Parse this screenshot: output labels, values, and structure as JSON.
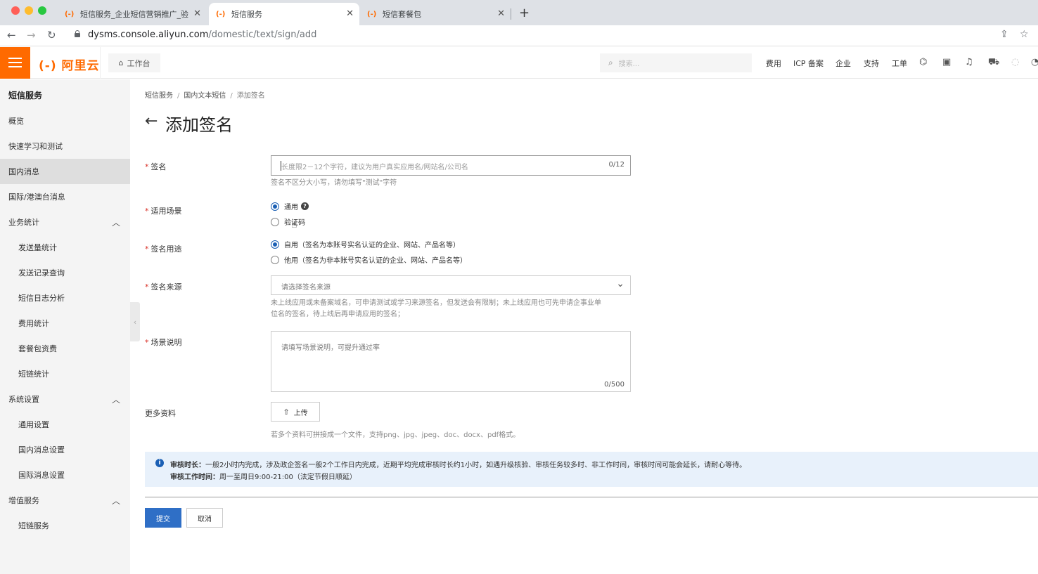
{
  "browser": {
    "tabs": [
      {
        "title": "短信服务_企业短信营销推广_验",
        "active": false
      },
      {
        "title": "短信服务",
        "active": true
      },
      {
        "title": "短信套餐包",
        "active": false
      }
    ],
    "new_tab": "+",
    "url_host": "dysms.console.aliyun.com",
    "url_path": "/domestic/text/sign/add"
  },
  "topbar": {
    "logo": "(-) 阿里云",
    "workbench": "工作台",
    "search_placeholder": "搜索...",
    "links": [
      "费用",
      "ICP 备案",
      "企业",
      "支持",
      "工单"
    ]
  },
  "sidebar": {
    "title": "短信服务",
    "items": [
      {
        "label": "概览"
      },
      {
        "label": "快速学习和测试"
      },
      {
        "label": "国内消息"
      },
      {
        "label": "国际/港澳台消息"
      },
      {
        "label": "业务统计"
      },
      {
        "label": "发送量统计"
      },
      {
        "label": "发送记录查询"
      },
      {
        "label": "短信日志分析"
      },
      {
        "label": "费用统计"
      },
      {
        "label": "套餐包资费"
      },
      {
        "label": "短链统计"
      },
      {
        "label": "系统设置"
      },
      {
        "label": "通用设置"
      },
      {
        "label": "国内消息设置"
      },
      {
        "label": "国际消息设置"
      },
      {
        "label": "增值服务"
      },
      {
        "label": "短链服务"
      }
    ]
  },
  "breadcrumb": [
    "短信服务",
    "国内文本短信",
    "添加签名"
  ],
  "page_title": "添加签名",
  "form": {
    "sign_name": {
      "label": "签名",
      "placeholder": "长度限2－12个字符，建议为用户真实应用名/网站名/公司名",
      "counter": "0/12",
      "help": "签名不区分大小写，请勿填写\"测试\"字符"
    },
    "scene": {
      "label": "适用场景",
      "options": [
        {
          "label": "通用",
          "selected": true
        },
        {
          "label": "验证码",
          "selected": false
        }
      ]
    },
    "purpose": {
      "label": "签名用途",
      "options": [
        {
          "label": "自用（签名为本账号实名认证的企业、网站、产品名等）",
          "selected": true
        },
        {
          "label": "他用（签名为非本账号实名认证的企业、网站、产品名等）",
          "selected": false
        }
      ]
    },
    "source": {
      "label": "签名来源",
      "placeholder": "请选择签名来源",
      "help1": "未上线应用或未备案域名，可申请测试或学习来源签名，但发送会有限制；未上线应用也可先申请企事业单",
      "help2": "位名的签名，待上线后再申请应用的签名；"
    },
    "description": {
      "label": "场景说明",
      "placeholder": "请填写场景说明，可提升通过率",
      "counter": "0/500"
    },
    "more": {
      "label": "更多资料",
      "upload": "上传",
      "help": "若多个资料可拼接成一个文件，支持png、jpg、jpeg、doc、docx、pdf格式。"
    }
  },
  "notice": {
    "line1_key": "审核时长：",
    "line1_text": "一般2小时内完成，涉及政企签名一般2个工作日内完成，近期平均完成审核时长约1小时，如遇升级核验、审核任务较多时、非工作时间，审核时间可能会延长，请耐心等待。",
    "line2_key": "审核工作时间：",
    "line2_text": "周一至周日9:00-21:00（法定节假日顺延）"
  },
  "buttons": {
    "submit": "提交",
    "cancel": "取消"
  }
}
